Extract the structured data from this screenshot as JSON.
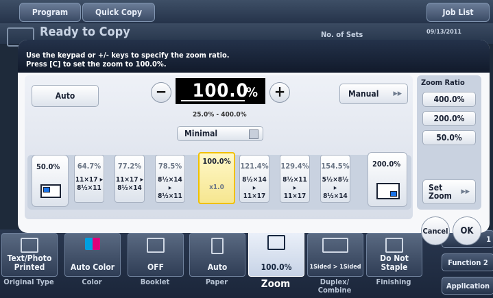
{
  "topbar": {
    "program": "Program",
    "quick_copy": "Quick Copy",
    "job_list": "Job List"
  },
  "status": {
    "title": "Ready to Copy",
    "sets_label": "No. of Sets",
    "date": "09/13/2011"
  },
  "dialog": {
    "instruction_line1": "Use the keypad or +/- keys to specify the zoom ratio.",
    "instruction_line2": "Press [C] to set the zoom to 100.0%.",
    "auto": "Auto",
    "zoom_value": "100.0",
    "zoom_unit": "%",
    "minus": "−",
    "plus": "+",
    "range": "25.0% - 400.0%",
    "minimal": "Minimal",
    "manual": "Manual",
    "presets": [
      {
        "value": "50.0%"
      },
      {
        "value": "64.7%",
        "size": "11×17 ▸\n8½×11"
      },
      {
        "value": "77.2%",
        "size": "11×17 ▸\n8½×14"
      },
      {
        "value": "78.5%",
        "size": "8½×14 ▸\n8½×11"
      },
      {
        "value": "100.0%",
        "size": "x1.0"
      },
      {
        "value": "121.4%",
        "size": "8½×14 ▸\n11×17"
      },
      {
        "value": "129.4%",
        "size": "8½×11 ▸\n11×17"
      },
      {
        "value": "154.5%",
        "size": "5½×8½ ▸\n8½×14"
      },
      {
        "value": "200.0%"
      }
    ],
    "zoom_ratio_title": "Zoom Ratio",
    "ratios": [
      "400.0%",
      "200.0%",
      "50.0%"
    ],
    "set_zoom": "Set Zoom",
    "cancel": "Cancel",
    "ok": "OK"
  },
  "functions": [
    {
      "value": "Text/Photo Printed",
      "label": "Original Type"
    },
    {
      "value": "Auto Color",
      "label": "Color"
    },
    {
      "value": "OFF",
      "label": "Booklet"
    },
    {
      "value": "Auto",
      "label": "Paper"
    },
    {
      "value": "100.0%",
      "label": "Zoom"
    },
    {
      "value": "1Sided > 1Sided",
      "label": "Duplex/ Combine"
    },
    {
      "value": "Do Not Staple",
      "label": "Finishing"
    }
  ],
  "side": {
    "function2": "Function 2",
    "application": "Application",
    "partial": "1"
  },
  "colors": {
    "selected_border": "#f0c000",
    "header_bg": "#111a2b"
  }
}
